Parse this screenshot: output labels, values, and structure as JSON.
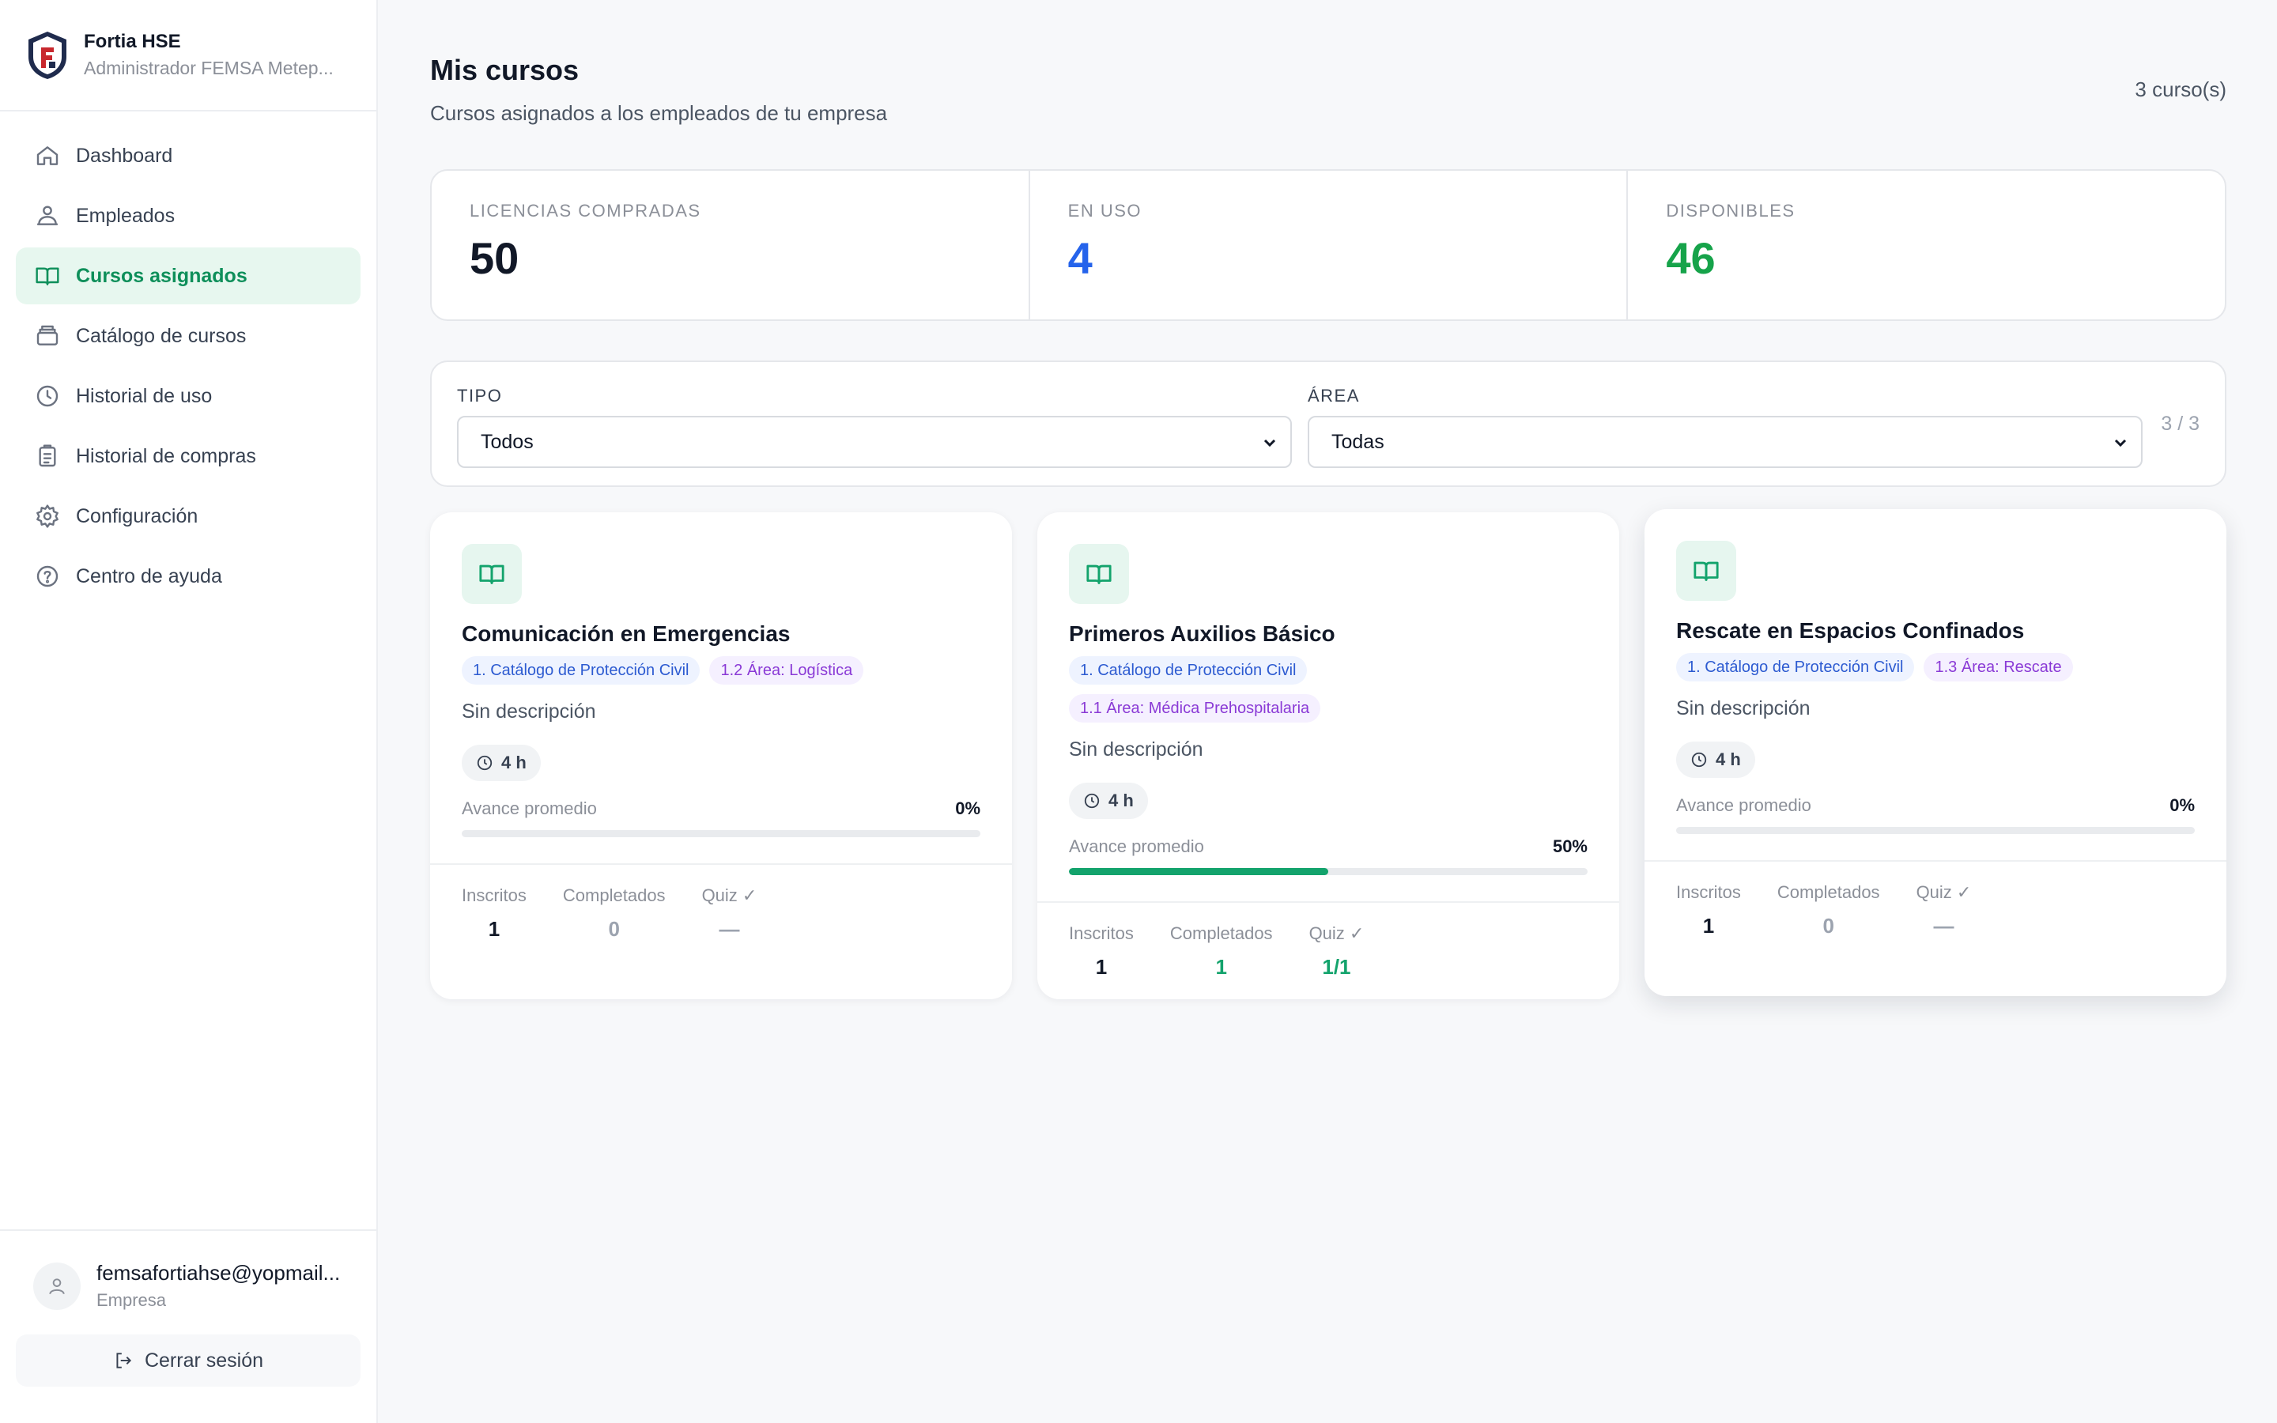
{
  "brand": {
    "name": "Fortia HSE",
    "subtitle": "Administrador FEMSA Metep..."
  },
  "nav": [
    {
      "label": "Dashboard",
      "icon": "home-icon",
      "active": false
    },
    {
      "label": "Empleados",
      "icon": "users-icon",
      "active": false
    },
    {
      "label": "Cursos asignados",
      "icon": "book-icon",
      "active": true
    },
    {
      "label": "Catálogo de cursos",
      "icon": "catalog-icon",
      "active": false
    },
    {
      "label": "Historial de uso",
      "icon": "clock-icon",
      "active": false
    },
    {
      "label": "Historial de compras",
      "icon": "receipt-icon",
      "active": false
    },
    {
      "label": "Configuración",
      "icon": "gear-icon",
      "active": false
    },
    {
      "label": "Centro de ayuda",
      "icon": "help-icon",
      "active": false
    }
  ],
  "user": {
    "email": "femsafortiahse@yopmail...",
    "role": "Empresa",
    "logout_label": "Cerrar sesión"
  },
  "header": {
    "title": "Mis cursos",
    "subtitle": "Cursos asignados a los empleados de tu empresa",
    "count": "3 curso(s)"
  },
  "stats": [
    {
      "label": "LICENCIAS COMPRADAS",
      "value": "50",
      "color": "#111827"
    },
    {
      "label": "EN USO",
      "value": "4",
      "color": "#2563eb"
    },
    {
      "label": "DISPONIBLES",
      "value": "46",
      "color": "#16a34a"
    }
  ],
  "filters": {
    "tipo": {
      "label": "TIPO",
      "value": "Todos"
    },
    "area": {
      "label": "ÁREA",
      "value": "Todas"
    },
    "count": "3 / 3"
  },
  "cards": [
    {
      "title": "Comunicación en Emergencias",
      "tags": [
        {
          "text": "1. Catálogo de Protección Civil",
          "kind": "blue"
        },
        {
          "text": "1.2 Área: Logística",
          "kind": "purple"
        }
      ],
      "description": "Sin descripción",
      "duration": "4 h",
      "progress_label": "Avance promedio",
      "progress_pct": "0%",
      "progress": 0,
      "metrics": [
        {
          "label": "Inscritos",
          "value": "1",
          "color": "#111827"
        },
        {
          "label": "Completados",
          "value": "0",
          "color": "#9ca3af"
        },
        {
          "label": "Quiz ✓",
          "value": "—",
          "color": "#9ca3af"
        }
      ]
    },
    {
      "title": "Primeros Auxilios Básico",
      "tags": [
        {
          "text": "1. Catálogo de Protección Civil",
          "kind": "blue"
        },
        {
          "text": "1.1 Área: Médica Prehospitalaria",
          "kind": "purple"
        }
      ],
      "description": "Sin descripción",
      "duration": "4 h",
      "progress_label": "Avance promedio",
      "progress_pct": "50%",
      "progress": 0.5,
      "metrics": [
        {
          "label": "Inscritos",
          "value": "1",
          "color": "#111827"
        },
        {
          "label": "Completados",
          "value": "1",
          "color": "#13a36c"
        },
        {
          "label": "Quiz ✓",
          "value": "1/1",
          "color": "#13a36c"
        }
      ]
    },
    {
      "title": "Rescate en Espacios Confinados",
      "tags": [
        {
          "text": "1. Catálogo de Protección Civil",
          "kind": "blue"
        },
        {
          "text": "1.3 Área: Rescate",
          "kind": "purple"
        }
      ],
      "description": "Sin descripción",
      "duration": "4 h",
      "progress_label": "Avance promedio",
      "progress_pct": "0%",
      "progress": 0,
      "metrics": [
        {
          "label": "Inscritos",
          "value": "1",
          "color": "#111827"
        },
        {
          "label": "Completados",
          "value": "0",
          "color": "#9ca3af"
        },
        {
          "label": "Quiz ✓",
          "value": "—",
          "color": "#9ca3af"
        }
      ]
    }
  ]
}
